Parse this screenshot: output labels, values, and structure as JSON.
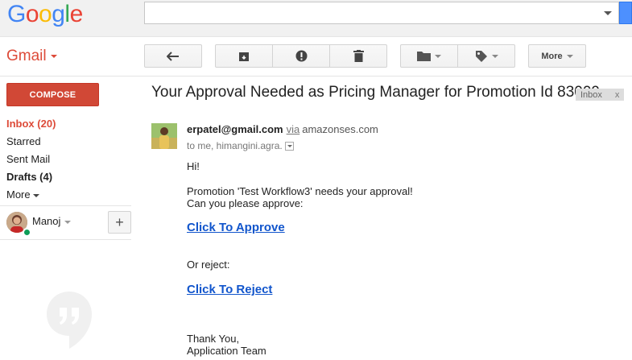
{
  "header": {
    "logo_letters": [
      {
        "char": "G",
        "color": "#4285f4"
      },
      {
        "char": "o",
        "color": "#ea4335"
      },
      {
        "char": "o",
        "color": "#fbbc05"
      },
      {
        "char": "g",
        "color": "#4285f4"
      },
      {
        "char": "l",
        "color": "#34a853"
      },
      {
        "char": "e",
        "color": "#ea4335"
      }
    ],
    "search_value": "",
    "search_placeholder": ""
  },
  "app": {
    "name": "Gmail",
    "accent_color": "#dd4b39"
  },
  "toolbar": {
    "back_icon": "back-arrow-icon",
    "archive_icon": "archive-icon",
    "spam_icon": "report-spam-icon",
    "delete_icon": "trash-icon",
    "move_icon": "folder-icon",
    "label_icon": "label-tag-icon",
    "more_label": "More"
  },
  "sidebar": {
    "compose_label": "COMPOSE",
    "items": [
      {
        "label": "Inbox (20)"
      },
      {
        "label": "Starred"
      },
      {
        "label": "Sent Mail"
      },
      {
        "label": "Drafts (4)"
      },
      {
        "label": "More"
      }
    ],
    "user_name": "Manoj",
    "add_label": "+",
    "presence_color": "#0f9d58"
  },
  "email": {
    "subject": "Your Approval Needed as Pricing Manager for Promotion Id 83009",
    "label_chip": "Inbox",
    "label_close": "x",
    "sender": "erpatel@gmail.com",
    "via_label": "via",
    "via_domain": "amazonses.com",
    "recipients": "to me, himangini.agra.",
    "body": {
      "greeting": "Hi!",
      "line1": "Promotion 'Test Workflow3' needs your approval!",
      "line2": "Can you please approve:",
      "approve_link": "Click To Approve",
      "or_reject": "Or reject:",
      "reject_link": "Click To Reject",
      "thanks": "Thank You,",
      "signature": "Application Team"
    },
    "link_color": "#1155cc"
  }
}
